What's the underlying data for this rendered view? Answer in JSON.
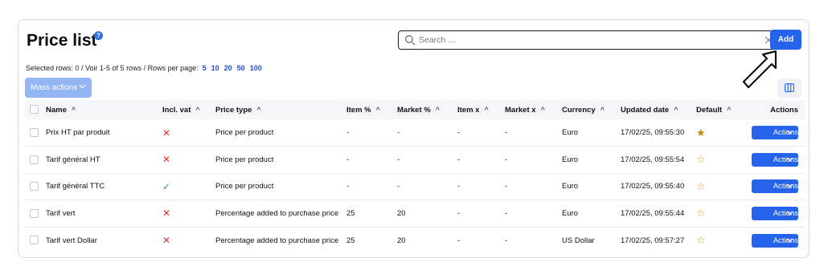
{
  "page": {
    "title": "Price list",
    "help_icon": "?"
  },
  "search": {
    "placeholder": "Search ...",
    "value": ""
  },
  "toolbar": {
    "add_label": "Add",
    "mass_actions_label": "Mass actions"
  },
  "selection": {
    "info": "Selected rows: 0 /  Voir 1-5 of 5 rows /  Rows per page:",
    "page_sizes": [
      "5",
      "10",
      "20",
      "50",
      "100"
    ]
  },
  "table": {
    "headers": [
      "Name",
      "Incl. vat",
      "Price type",
      "Item %",
      "Market %",
      "Item x",
      "Market x",
      "Currency",
      "Updated date",
      "Default",
      "Actions"
    ],
    "sort_icon": "^",
    "rows": [
      {
        "name": "Prix HT par produit",
        "incl_vat": false,
        "price_type": "Price per product",
        "item_pct": "-",
        "market_pct": "-",
        "item_x": "-",
        "market_x": "-",
        "currency": "Euro",
        "updated": "17/02/25, 09:55:30",
        "default": true,
        "actions_label": "Actions"
      },
      {
        "name": "Tarif général HT",
        "incl_vat": false,
        "price_type": "Price per product",
        "item_pct": "-",
        "market_pct": "-",
        "item_x": "-",
        "market_x": "-",
        "currency": "Euro",
        "updated": "17/02/25, 09:55:54",
        "default": false,
        "actions_label": "Actions"
      },
      {
        "name": "Tarif général TTC",
        "incl_vat": true,
        "price_type": "Price per product",
        "item_pct": "-",
        "market_pct": "-",
        "item_x": "-",
        "market_x": "-",
        "currency": "Euro",
        "updated": "17/02/25, 09:55:40",
        "default": false,
        "actions_label": "Actions"
      },
      {
        "name": "Tarif vert",
        "incl_vat": false,
        "price_type": "Percentage added to purchase price",
        "item_pct": "25",
        "market_pct": "20",
        "item_x": "-",
        "market_x": "-",
        "currency": "Euro",
        "updated": "17/02/25, 09:55:44",
        "default": false,
        "actions_label": "Actions"
      },
      {
        "name": "Tarif vert Dollar",
        "incl_vat": false,
        "price_type": "Percentage added to purchase price",
        "item_pct": "25",
        "market_pct": "20",
        "item_x": "-",
        "market_x": "-",
        "currency": "US Dollar",
        "updated": "17/02/25, 09:57:27",
        "default": false,
        "actions_label": "Actions"
      }
    ]
  },
  "symbols": {
    "vat_yes": "✓",
    "vat_no": "✕",
    "star_on": "★",
    "star_off": "☆"
  },
  "icons": {
    "search": "search-icon",
    "clear": "close-icon",
    "columns": "columns-icon",
    "chevron": "chevron-down-icon",
    "arrow": "hand-drawn-arrow-icon",
    "star": "star-icon"
  },
  "colors": {
    "primary": "#2563eb",
    "primary_disabled": "#93b4f5",
    "error": "#e03131",
    "success": "#2f9e44",
    "star": "#c98a07"
  }
}
